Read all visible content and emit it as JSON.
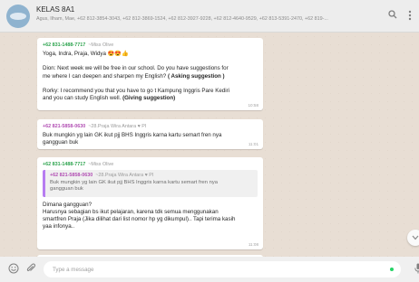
{
  "header": {
    "title": "KELAS 8A1",
    "members": "Agus, Ilham, Mae, +62 812-3854-3043, +62 812-3869-1524, +62 812-3927-9228, +62 812-4640-9529, +62 813-5391-2470, +62 819-...",
    "search_icon": "search-icon",
    "menu_icon": "menu-icon"
  },
  "colors": {
    "olive": "#2ea44f",
    "praja": "#b14eb3",
    "quote_bar": "#b77df1",
    "chat_bg": "#e8ded4"
  },
  "messages": [
    {
      "phone": "+62 831-1488-7717",
      "name": "~Miss Olive",
      "lines": [
        "Yoga, Indra, Praja, Widya 😍😍👍",
        "",
        "Dion: Next week we will be free in our school. Do you have suggestions for",
        "me where I can deepen and sharpen my English? ( Asking suggestion )",
        "",
        "Rorky: I recommend you that you have to go t Kampung Inggris Pare Kediri",
        "and you can study English well. (Giving suggestion)"
      ],
      "time": "10:58"
    },
    {
      "phone": "+62 821-5858-0630",
      "name": "~28.Praja Wira Antara ♥ PI",
      "lines": [
        "Buk mungkin yg lain GK ikut pjj BHS Inggris karna kartu semart fren nya",
        "gangguan buk"
      ],
      "time": "11:01"
    },
    {
      "phone": "+62 831-1488-7717",
      "name": "~Miss Olive",
      "quote": {
        "phone": "+62 821-5858-0630",
        "name": "~28.Praja Wira Antara ♥ PI",
        "lines": [
          "Buk mungkin yg lain GK ikut pjj BHS Inggris karna kartu semart fren nya",
          "gangguan buk"
        ]
      },
      "lines": [
        "Dimana gangguan?",
        "Harusnya sebagian bs ikut pelajaran, karena tdk semua menggunakan",
        "smartfren Praja (Jika dilihat dari list nomor hp yg dikumpul).. Tapi terima kasih",
        "yaa infonya.."
      ],
      "time": "11:08"
    }
  ],
  "composer": {
    "placeholder": "Type a message",
    "emoji_icon": "emoji-icon",
    "attach_icon": "attach-icon",
    "mic_icon": "mic-icon"
  },
  "scroll_down_icon": "chevron-down-icon"
}
